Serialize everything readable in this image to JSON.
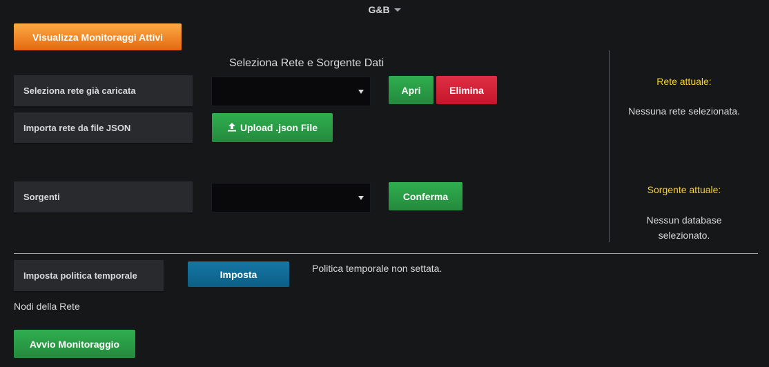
{
  "header": {
    "title": "G&B"
  },
  "toolbar": {
    "active_monitors_label": "Visualizza Monitoraggi Attivi"
  },
  "network_source": {
    "section_title": "Seleziona Rete e Sorgente Dati",
    "select_network_label": "Seleziona rete già caricata",
    "select_network_value": "",
    "open_label": "Apri",
    "delete_label": "Elimina",
    "import_label": "Importa rete da file JSON",
    "upload_label": "Upload .json File",
    "sources_label": "Sorgenti",
    "sources_value": "",
    "confirm_label": "Conferma"
  },
  "status_panel": {
    "current_network_title": "Rete attuale:",
    "current_network_value": "Nessuna rete selezionata.",
    "current_source_title": "Sorgente attuale:",
    "current_source_value": "Nessun database selezionato."
  },
  "time_policy": {
    "label": "Imposta politica temporale",
    "set_label": "Imposta",
    "status": "Politica temporale non settata."
  },
  "nodes": {
    "title": "Nodi della Rete"
  },
  "footer": {
    "start_label": "Avvio Monitoraggio"
  },
  "colors": {
    "accent_yellow": "#f9d12e",
    "orange": "#eb7b18",
    "green": "#299c46",
    "red": "#e02f44",
    "blue": "#1676a4"
  }
}
